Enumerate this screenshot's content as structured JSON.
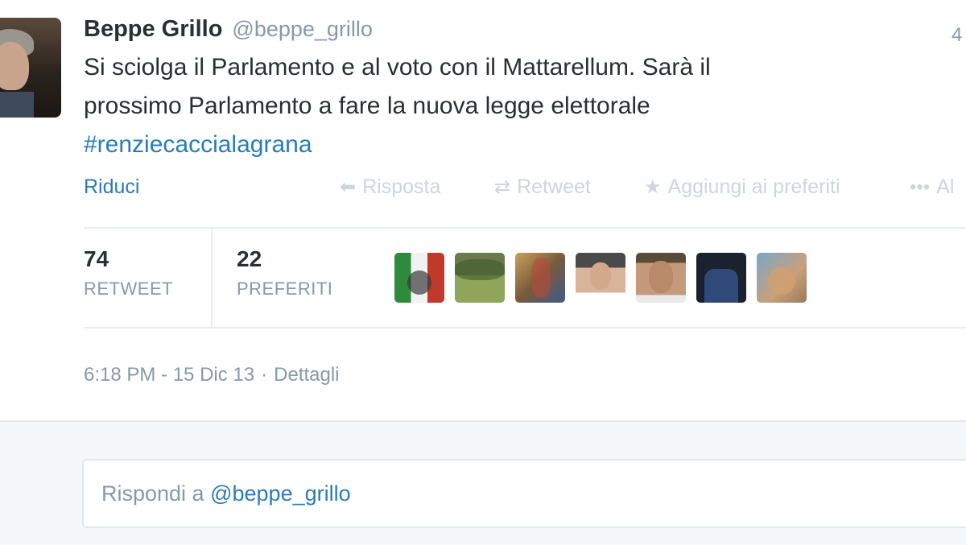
{
  "tweet": {
    "author": {
      "fullname": "Beppe Grillo",
      "screen_name": "@beppe_grillo"
    },
    "time_short": "4",
    "text_lines": [
      "Si sciolga il Parlamento e al voto con il Mattarellum. Sarà il",
      "prossimo Parlamento a fare la nuova legge elettorale"
    ],
    "hashtag": "#renziecaccialagrana",
    "collapse_label": "Riduci",
    "actions": {
      "reply": "Risposta",
      "retweet": "Retweet",
      "favorite": "Aggiungi ai preferiti",
      "more": "Al"
    },
    "icons": {
      "reply": "reply-arrow-icon",
      "retweet": "retweet-icon",
      "favorite": "star-icon",
      "more": "ellipsis-icon"
    },
    "stats": {
      "retweets": {
        "count": "74",
        "label": "RETWEET"
      },
      "favorites": {
        "count": "22",
        "label": "PREFERITI"
      }
    },
    "favoriters_count_shown": 7,
    "meta": {
      "timestamp": "6:18 PM - 15 Dic 13",
      "separator": "·",
      "details_label": "Dettagli"
    }
  },
  "reply": {
    "placeholder_prefix": "Rispondi a",
    "placeholder_mention": "@beppe_grillo"
  },
  "colors": {
    "link": "#2b7bb9",
    "muted": "#8899a6",
    "text": "#292f33",
    "action_disabled": "#ccd6dd"
  }
}
